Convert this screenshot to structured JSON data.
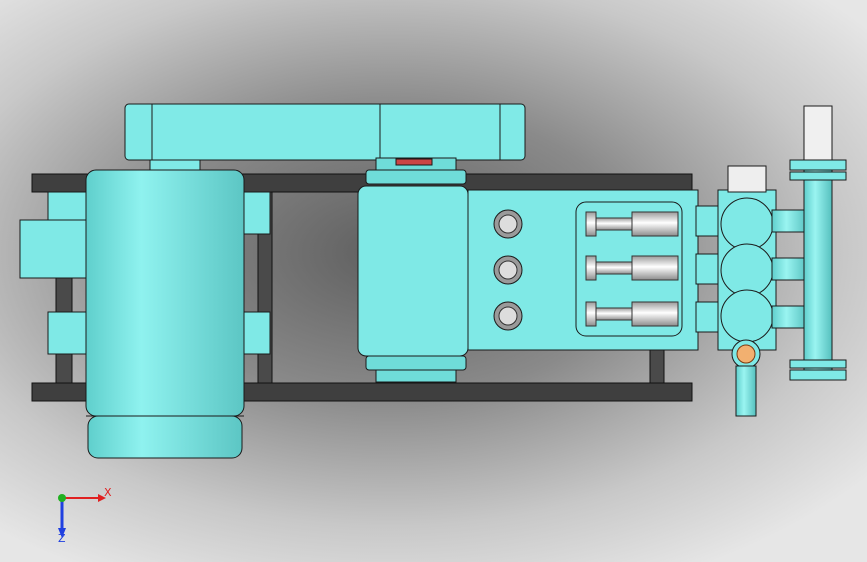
{
  "colors": {
    "body": "#7fe9e6",
    "body_dark": "#5cc9c7",
    "frame": "#4a4a4a",
    "steel": "#e8e8e8",
    "outline": "#1a1a1a",
    "axis_x": "#e02020",
    "axis_y": "#20b020",
    "axis_z": "#2040e0"
  },
  "triad": {
    "x_label": "X",
    "z_label": "Z"
  }
}
